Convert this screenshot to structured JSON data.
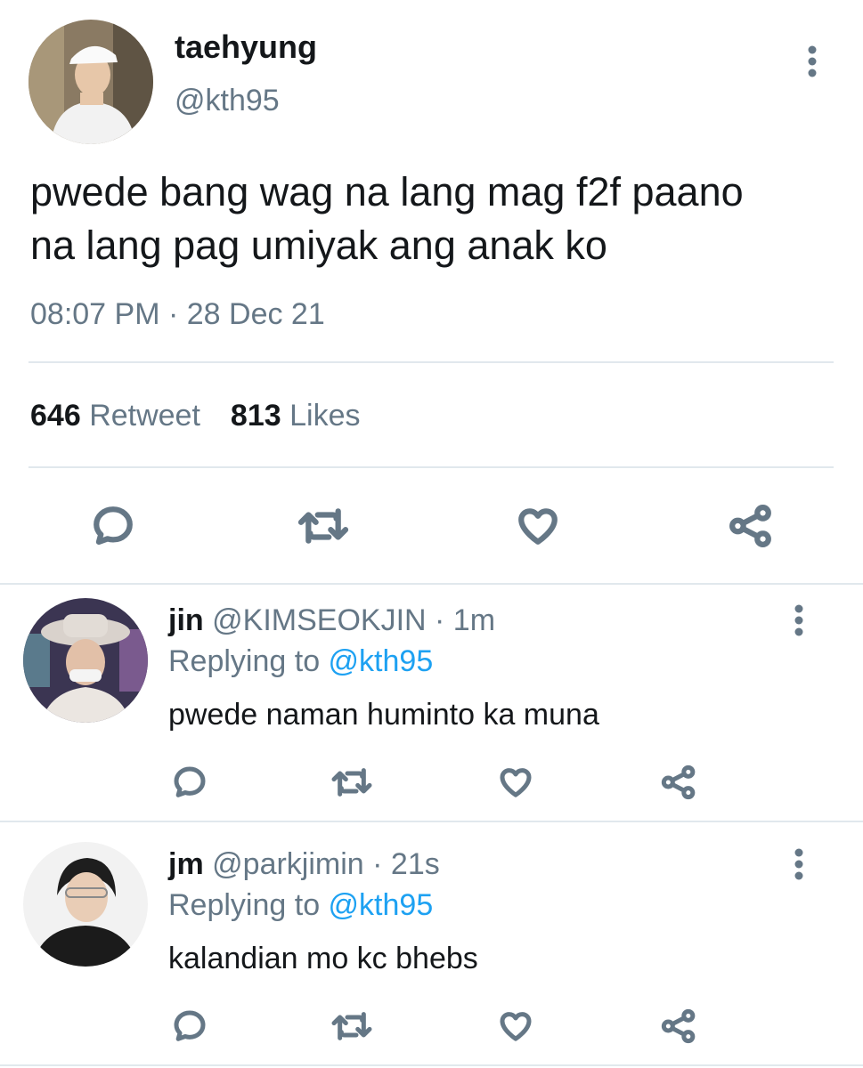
{
  "tweet": {
    "author_name": "taehyung",
    "author_handle": "@kth95",
    "text_line1": "pwede bang wag na lang mag f2f paano",
    "text_line2": "na lang pag umiyak ang anak ko",
    "time": "08:07 PM",
    "separator": " · ",
    "date": "28 Dec 21",
    "retweet_count": "646",
    "retweet_label": "Retweet",
    "like_count": "813",
    "like_label": "Likes"
  },
  "replies": [
    {
      "name": "jin",
      "handle": "@KIMSEOKJIN",
      "separator": " · ",
      "time": "1m",
      "replying_prefix": "Replying to ",
      "replying_to": "@kth95",
      "text": "pwede naman huminto ka muna"
    },
    {
      "name": "jm",
      "handle": "@parkjimin",
      "separator": " · ",
      "time": "21s",
      "replying_prefix": "Replying to ",
      "replying_to": "@kth95",
      "text": "kalandian mo kc bhebs"
    }
  ],
  "icons": {
    "reply": "reply-bubble-icon",
    "retweet": "retweet-icon",
    "like": "heart-icon",
    "share": "share-icon",
    "more": "vertical-dots-icon"
  },
  "colors": {
    "text": "#14171a",
    "secondary": "#657786",
    "link": "#1da1f2",
    "divider": "#e1e8ed"
  }
}
